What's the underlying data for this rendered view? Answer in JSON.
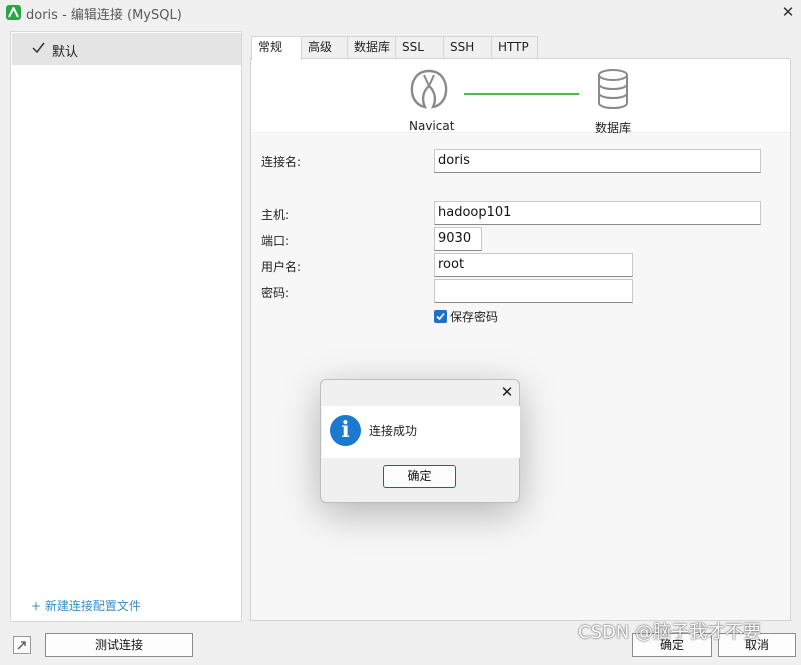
{
  "window": {
    "title": "doris - 编辑连接 (MySQL)"
  },
  "sidebar": {
    "items": [
      {
        "label": "默认",
        "selected": true
      }
    ],
    "new_profile_link": "+ 新建连接配置文件"
  },
  "tabs": [
    {
      "label": "常规",
      "active": true
    },
    {
      "label": "高级"
    },
    {
      "label": "数据库"
    },
    {
      "label": "SSL"
    },
    {
      "label": "SSH"
    },
    {
      "label": "HTTP"
    }
  ],
  "diagram": {
    "client_label": "Navicat",
    "server_label": "数据库",
    "line_color": "#4cbb4c"
  },
  "form": {
    "connection_name": {
      "label": "连接名:",
      "value": "doris"
    },
    "host": {
      "label": "主机:",
      "value": "hadoop101"
    },
    "port": {
      "label": "端口:",
      "value": "9030"
    },
    "username": {
      "label": "用户名:",
      "value": "root"
    },
    "password": {
      "label": "密码:",
      "value": ""
    },
    "save_password": {
      "label": "保存密码",
      "checked": true
    }
  },
  "footer": {
    "test_button": "测试连接",
    "ok_button": "确定",
    "cancel_button": "取消"
  },
  "watermark": "CSDN @脑子我才不要",
  "dialog": {
    "message": "连接成功",
    "ok_button": "确定",
    "icon": "info-icon",
    "accent": "#1c79d0"
  }
}
